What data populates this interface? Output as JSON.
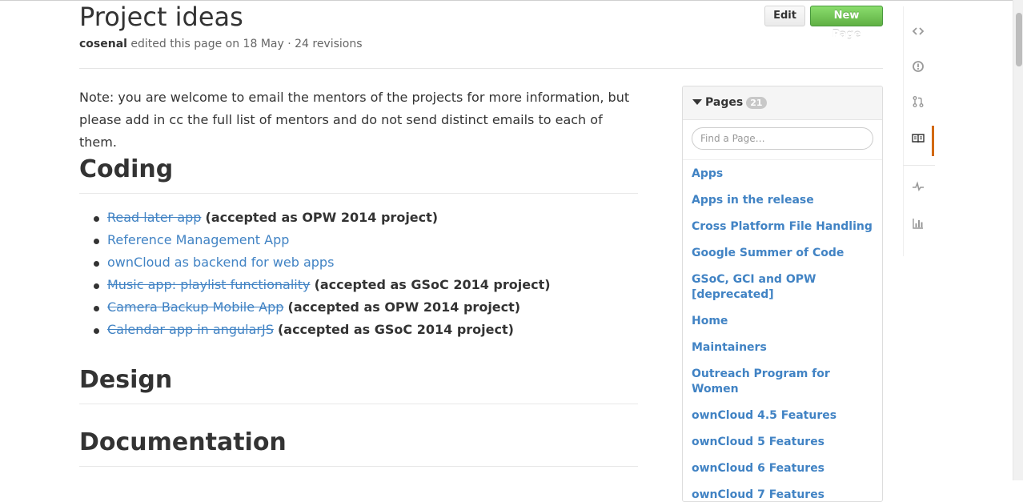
{
  "header": {
    "title": "Project ideas",
    "author": "cosenal",
    "edit_info": " edited this page on 18 May · 24 revisions",
    "edit_label": "Edit",
    "new_page_label": "New Page"
  },
  "content": {
    "note": "Note: you are welcome to email the mentors of the projects for more information, but please add in cc the full list of mentors and do not send distinct emails to each of them.",
    "coding_heading": "Coding",
    "projects": [
      {
        "link": "Read later app",
        "struck": true,
        "note": "(accepted as OPW 2014 project)"
      },
      {
        "link": "Reference Management App",
        "struck": false,
        "note": ""
      },
      {
        "link": "ownCloud as backend for web apps",
        "struck": false,
        "note": ""
      },
      {
        "link": "Music app: playlist functionality",
        "struck": true,
        "note": "(accepted as GSoC 2014 project)"
      },
      {
        "link": "Camera Backup Mobile App",
        "struck": true,
        "note": "(accepted as OPW 2014 project)"
      },
      {
        "link": "Calendar app in angularJS",
        "struck": true,
        "note": "(accepted as GSoC 2014 project)"
      }
    ],
    "design_heading": "Design",
    "documentation_heading": "Documentation"
  },
  "pages": {
    "title": "Pages",
    "count": "21",
    "search_placeholder": "Find a Page…",
    "items": [
      "Apps",
      "Apps in the release",
      "Cross Platform File Handling",
      "Google Summer of Code",
      "GSoC, GCI and OPW [deprecated]",
      "Home",
      "Maintainers",
      "Outreach Program for Women",
      "ownCloud 4.5 Features",
      "ownCloud 5 Features",
      "ownCloud 6 Features",
      "ownCloud 7 Features"
    ]
  },
  "sidebar_icons": [
    "code-icon",
    "issues-icon",
    "pull-request-icon",
    "wiki-icon",
    "pulse-icon",
    "graphs-icon"
  ],
  "colors": {
    "link": "#4183c4",
    "new_page_button": "#60b044",
    "active_tab": "#d26911"
  }
}
